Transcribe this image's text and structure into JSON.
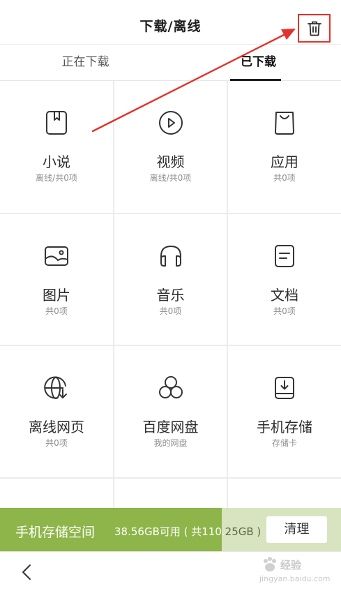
{
  "header": {
    "title": "下载/离线",
    "trash_icon": "trash-icon"
  },
  "tabs": [
    {
      "label": "正在下载",
      "active": false
    },
    {
      "label": "已下载",
      "active": true
    }
  ],
  "grid": {
    "items": [
      {
        "name": "小说",
        "sub": "离线/共0项",
        "icon": "bookmark-book-icon"
      },
      {
        "name": "视频",
        "sub": "离线/共0项",
        "icon": "play-circle-icon"
      },
      {
        "name": "应用",
        "sub": "共0项",
        "icon": "shopping-bag-icon"
      },
      {
        "name": "图片",
        "sub": "共0项",
        "icon": "picture-icon"
      },
      {
        "name": "音乐",
        "sub": "共0项",
        "icon": "headphones-icon"
      },
      {
        "name": "文档",
        "sub": "共0项",
        "icon": "document-icon"
      },
      {
        "name": "离线网页",
        "sub": "共0项",
        "icon": "globe-download-icon"
      },
      {
        "name": "百度网盘",
        "sub": "我的网盘",
        "icon": "cloud-circles-icon"
      },
      {
        "name": "手机存储",
        "sub": "存储卡",
        "icon": "storage-download-icon"
      }
    ]
  },
  "storage": {
    "label": "手机存储空间",
    "capacity_main": "38.56GB可用 ( 共110.",
    "capacity_rest": "25GB )",
    "used_fraction": 0.65,
    "clean_label": "清理"
  },
  "footer": {
    "back_icon": "chevron-left-icon",
    "watermark_brand": "经验",
    "watermark_url": "jingyan.baidu.com"
  },
  "colors": {
    "storage_fill": "#8db549",
    "storage_track": "#d8e4bf",
    "annotation": "#e4312b"
  }
}
